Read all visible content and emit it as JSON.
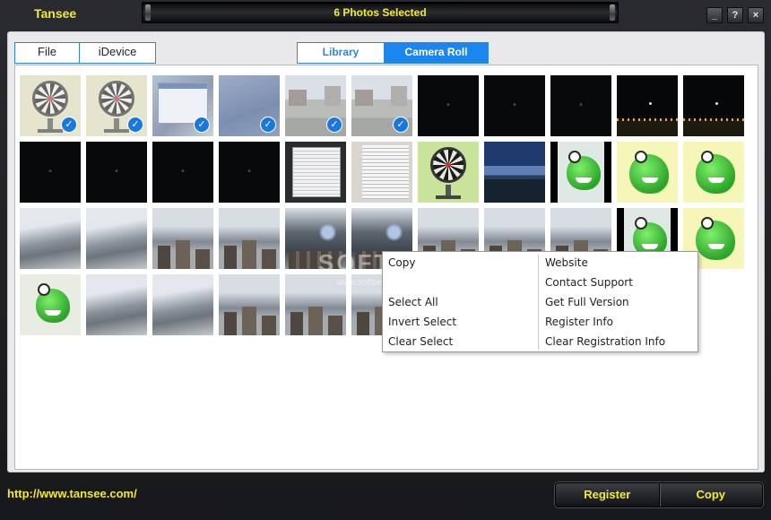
{
  "app": {
    "title": "Tansee",
    "status": "6 Photos Selected",
    "window_buttons": {
      "minimize": "_",
      "help": "?",
      "close": "×"
    }
  },
  "source_tabs": [
    {
      "label": "File",
      "active": false
    },
    {
      "label": "iDevice",
      "active": false
    }
  ],
  "view_tabs": [
    {
      "label": "Library",
      "active": false
    },
    {
      "label": "Camera Roll",
      "active": true
    }
  ],
  "photos": {
    "selected_count": 6,
    "check_icon": "✓",
    "thumbnails": [
      {
        "kind": "dart",
        "selected": true
      },
      {
        "kind": "dart",
        "selected": true
      },
      {
        "kind": "screen",
        "selected": true
      },
      {
        "kind": "blue",
        "selected": true
      },
      {
        "kind": "street",
        "selected": true
      },
      {
        "kind": "street",
        "selected": true
      },
      {
        "kind": "night",
        "selected": false
      },
      {
        "kind": "night",
        "selected": false
      },
      {
        "kind": "night",
        "selected": false
      },
      {
        "kind": "night-lights",
        "selected": false
      },
      {
        "kind": "night-lights",
        "selected": false
      },
      {
        "kind": "night",
        "selected": false
      },
      {
        "kind": "night",
        "selected": false
      },
      {
        "kind": "night",
        "selected": false
      },
      {
        "kind": "night",
        "selected": false
      },
      {
        "kind": "doc",
        "selected": false
      },
      {
        "kind": "doc2",
        "selected": false
      },
      {
        "kind": "dart-green",
        "selected": false
      },
      {
        "kind": "lake",
        "selected": false
      },
      {
        "kind": "frog-dark",
        "selected": false
      },
      {
        "kind": "frog-light",
        "selected": false
      },
      {
        "kind": "frog-light",
        "selected": false
      },
      {
        "kind": "sky",
        "selected": false
      },
      {
        "kind": "sky",
        "selected": false
      },
      {
        "kind": "sky-city",
        "selected": false
      },
      {
        "kind": "sky-city",
        "selected": false
      },
      {
        "kind": "storm",
        "selected": false
      },
      {
        "kind": "storm",
        "selected": false
      },
      {
        "kind": "sky-city",
        "selected": false
      },
      {
        "kind": "sky-city",
        "selected": false
      },
      {
        "kind": "sky-city",
        "selected": false
      },
      {
        "kind": "frog-dark",
        "selected": false
      },
      {
        "kind": "frog-light",
        "selected": false
      },
      {
        "kind": "frog",
        "selected": false
      },
      {
        "kind": "sky",
        "selected": false
      },
      {
        "kind": "sky",
        "selected": false
      },
      {
        "kind": "sky-city",
        "selected": false
      },
      {
        "kind": "sky-city",
        "selected": false
      },
      {
        "kind": "sky-city",
        "selected": false
      }
    ]
  },
  "watermark": {
    "text": "SOFTPEDIA",
    "sub": "www.softpedia.com"
  },
  "context_menu": {
    "left": [
      "Copy",
      "",
      "Select All",
      "Invert Select",
      "Clear Select"
    ],
    "right": [
      "Website",
      "Contact Support",
      "Get Full Version",
      "Register Info",
      "Clear Registration Info"
    ]
  },
  "footer": {
    "url": "http://www.tansee.com/",
    "register_label": "Register",
    "copy_label": "Copy"
  },
  "colors": {
    "accent_yellow": "#f4ea2a",
    "tab_blue": "#1b86f0",
    "check_blue": "#1978e0"
  }
}
